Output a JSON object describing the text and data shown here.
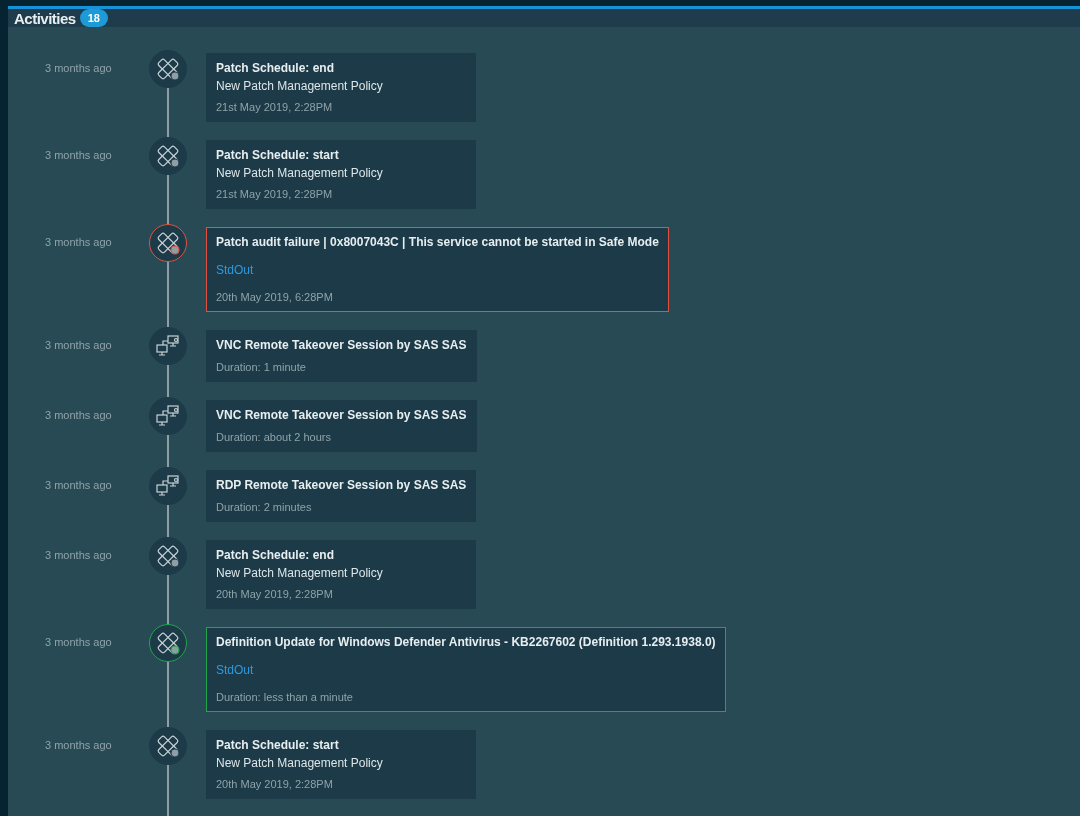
{
  "header": {
    "title": "Activities",
    "count": "18"
  },
  "activities": [
    {
      "time": "3 months ago",
      "kind": "patch",
      "failed": false,
      "succeeded": false,
      "title": "Patch Schedule: end",
      "subtitle": "New Patch Management Policy",
      "footer": "21st May 2019, 2:28PM"
    },
    {
      "time": "3 months ago",
      "kind": "patch",
      "failed": false,
      "succeeded": false,
      "title": "Patch Schedule: start",
      "subtitle": "New Patch Management Policy",
      "footer": "21st May 2019, 2:28PM"
    },
    {
      "time": "3 months ago",
      "kind": "patch",
      "failed": true,
      "succeeded": false,
      "title": "Patch audit failure | 0x8007043C | This service cannot be started in Safe Mode",
      "link": "StdOut",
      "footer": "20th May 2019, 6:28PM"
    },
    {
      "time": "3 months ago",
      "kind": "remote",
      "failed": false,
      "succeeded": false,
      "title": "VNC Remote Takeover Session by SAS SAS",
      "footer": "Duration: 1 minute"
    },
    {
      "time": "3 months ago",
      "kind": "remote",
      "failed": false,
      "succeeded": false,
      "title": "VNC Remote Takeover Session by SAS SAS",
      "footer": "Duration: about 2 hours"
    },
    {
      "time": "3 months ago",
      "kind": "remote",
      "failed": false,
      "succeeded": false,
      "title": "RDP Remote Takeover Session by SAS SAS",
      "footer": "Duration: 2 minutes"
    },
    {
      "time": "3 months ago",
      "kind": "patch",
      "failed": false,
      "succeeded": false,
      "title": "Patch Schedule: end",
      "subtitle": "New Patch Management Policy",
      "footer": "20th May 2019, 2:28PM"
    },
    {
      "time": "3 months ago",
      "kind": "patch",
      "failed": false,
      "succeeded": true,
      "title": "Definition Update for Windows Defender Antivirus - KB2267602 (Definition 1.293.1938.0)",
      "link": "StdOut",
      "footer": "Duration: less than a minute"
    },
    {
      "time": "3 months ago",
      "kind": "patch",
      "failed": false,
      "succeeded": false,
      "title": "Patch Schedule: start",
      "subtitle": "New Patch Management Policy",
      "footer": "20th May 2019, 2:28PM"
    }
  ]
}
